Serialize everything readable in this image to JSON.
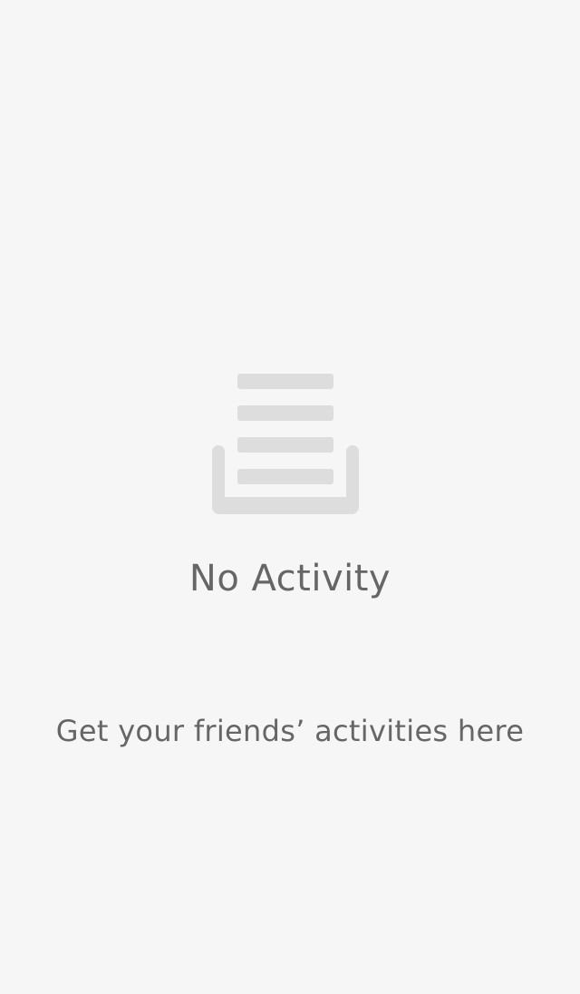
{
  "empty_state": {
    "icon": "activity-tray-icon",
    "title": "No Activity",
    "subtitle": "Get your friends’ activities here"
  },
  "colors": {
    "background": "#f6f6f6",
    "text": "#666666",
    "icon": "#dddddd"
  }
}
